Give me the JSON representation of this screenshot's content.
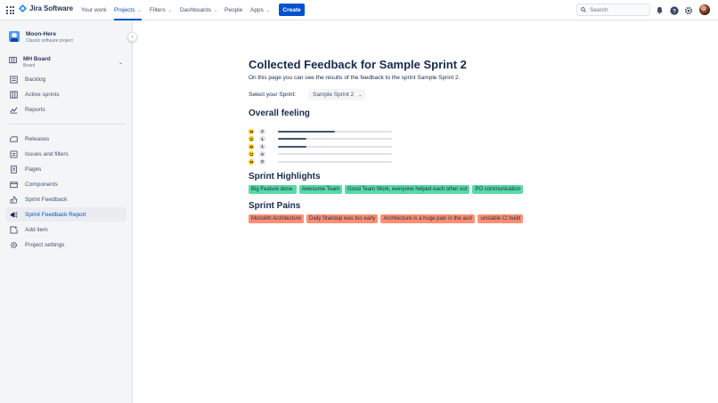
{
  "topnav": {
    "product_name": "Jira Software",
    "items": [
      {
        "label": "Your work",
        "dropdown": false,
        "active": false
      },
      {
        "label": "Projects",
        "dropdown": true,
        "active": true
      },
      {
        "label": "Filters",
        "dropdown": true,
        "active": false
      },
      {
        "label": "Dashboards",
        "dropdown": true,
        "active": false
      },
      {
        "label": "People",
        "dropdown": false,
        "active": false
      },
      {
        "label": "Apps",
        "dropdown": true,
        "active": false
      }
    ],
    "create_label": "Create",
    "search_placeholder": "Search",
    "icons": [
      "apps-grid-icon",
      "notifications-icon",
      "help-icon",
      "settings-icon",
      "user-avatar"
    ]
  },
  "sidebar": {
    "project_name": "Moon-Here",
    "project_type": "Classic software project",
    "board_name": "MH Board",
    "board_type": "Board",
    "items": [
      {
        "label": "Backlog",
        "icon": "backlog-icon",
        "active": false
      },
      {
        "label": "Active sprints",
        "icon": "active-sprints-icon",
        "active": false
      },
      {
        "label": "Reports",
        "icon": "reports-icon",
        "active": false
      },
      {
        "label": "Releases",
        "icon": "releases-icon",
        "active": false
      },
      {
        "label": "Issues and filters",
        "icon": "issues-icon",
        "active": false
      },
      {
        "label": "Pages",
        "icon": "pages-icon",
        "active": false
      },
      {
        "label": "Components",
        "icon": "components-icon",
        "active": false
      },
      {
        "label": "Sprint Feedback",
        "icon": "sprint-feedback-icon",
        "active": false
      },
      {
        "label": "Sprint Feedback Report",
        "icon": "sprint-feedback-report-icon",
        "active": true
      },
      {
        "label": "Add item",
        "icon": "add-item-icon",
        "active": false
      },
      {
        "label": "Project settings",
        "icon": "project-settings-icon",
        "active": false
      }
    ]
  },
  "main": {
    "title": "Collected Feedback for Sample Sprint 2",
    "description": "On this page you can see the results of the feedback to the sprint Sample Sprint 2.",
    "sprint_label": "Select your Sprint:",
    "sprint_selected": "Sample Sprint 2",
    "overall_heading": "Overall feeling",
    "ratings": [
      {
        "count": "2",
        "fraction": 0.5
      },
      {
        "count": "1",
        "fraction": 0.25
      },
      {
        "count": "1",
        "fraction": 0.25
      },
      {
        "count": "0",
        "fraction": 0
      },
      {
        "count": "0",
        "fraction": 0
      }
    ],
    "highlights_heading": "Sprint Highlights",
    "highlights": [
      "Big Feature done.",
      "Awesome Team",
      "Good Team Work, everyone helped each other out",
      "PO communication"
    ],
    "pains_heading": "Sprint Pains",
    "pains": [
      "Monolith Architecture",
      "Daily Standup was too early",
      "Architecture is a huge pain in the ass!",
      "unstable CI build"
    ]
  },
  "colors": {
    "brand_blue": "#0052cc",
    "highlight_tag": "#57d9a3",
    "pain_tag": "#ff8f73",
    "bar_fill": "#42526e",
    "emoji": "#ffc400"
  }
}
